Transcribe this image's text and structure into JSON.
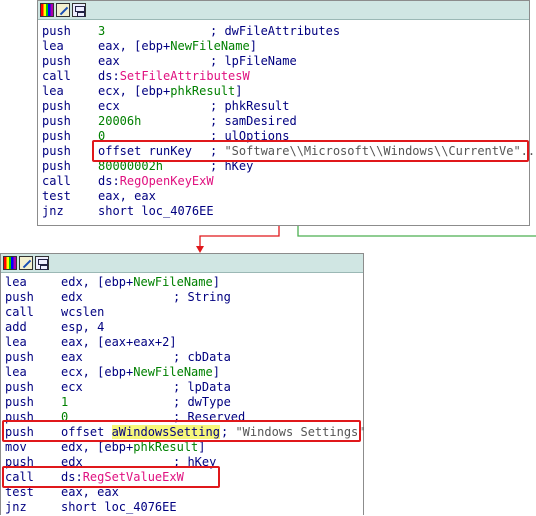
{
  "top_block": {
    "lines": [
      {
        "mn": "push",
        "op": [
          {
            "t": "3",
            "c": "num"
          }
        ],
        "cm": "; dwFileAttributes"
      },
      {
        "mn": "lea",
        "op": [
          {
            "t": "eax, [ebp+",
            "c": "op"
          },
          {
            "t": "NewFileName",
            "c": "sym"
          },
          {
            "t": "]",
            "c": "op"
          }
        ],
        "cm": ""
      },
      {
        "mn": "push",
        "op": [
          {
            "t": "eax",
            "c": "op"
          }
        ],
        "cm": "; lpFileName"
      },
      {
        "mn": "call",
        "op": [
          {
            "t": "ds:",
            "c": "op"
          },
          {
            "t": "SetFileAttributesW",
            "c": "imp"
          }
        ],
        "cm": ""
      },
      {
        "mn": "lea",
        "op": [
          {
            "t": "ecx, [ebp+",
            "c": "op"
          },
          {
            "t": "phkResult",
            "c": "sym"
          },
          {
            "t": "]",
            "c": "op"
          }
        ],
        "cm": ""
      },
      {
        "mn": "push",
        "op": [
          {
            "t": "ecx",
            "c": "op"
          }
        ],
        "cm": "; phkResult"
      },
      {
        "mn": "push",
        "op": [
          {
            "t": "20006h",
            "c": "num"
          }
        ],
        "cm": "; samDesired"
      },
      {
        "mn": "push",
        "op": [
          {
            "t": "0",
            "c": "num"
          }
        ],
        "cm": "; ulOptions"
      },
      {
        "mn": "push",
        "op": [
          {
            "t": "offset runKey",
            "c": "op"
          }
        ],
        "cm": "; ",
        "str": "\"Software\\\\Microsoft\\\\Windows\\\\CurrentVe\".."
      },
      {
        "mn": "push",
        "op": [
          {
            "t": "80000002h",
            "c": "num"
          }
        ],
        "cm": "; hKey"
      },
      {
        "mn": "call",
        "op": [
          {
            "t": "ds:",
            "c": "op"
          },
          {
            "t": "RegOpenKeyExW",
            "c": "imp"
          }
        ],
        "cm": ""
      },
      {
        "mn": "test",
        "op": [
          {
            "t": "eax, eax",
            "c": "op"
          }
        ],
        "cm": ""
      },
      {
        "mn": "jnz",
        "op": [
          {
            "t": "short loc_4076EE",
            "c": "op"
          }
        ],
        "cm": ""
      }
    ]
  },
  "bottom_block": {
    "lines": [
      {
        "mn": "lea",
        "op": [
          {
            "t": "edx, [ebp+",
            "c": "op"
          },
          {
            "t": "NewFileName",
            "c": "sym"
          },
          {
            "t": "]",
            "c": "op"
          }
        ],
        "cm": ""
      },
      {
        "mn": "push",
        "op": [
          {
            "t": "edx",
            "c": "op"
          }
        ],
        "cm": "; String"
      },
      {
        "mn": "call",
        "op": [
          {
            "t": "wcslen",
            "c": "op"
          }
        ],
        "cm": ""
      },
      {
        "mn": "add",
        "op": [
          {
            "t": "esp, 4",
            "c": "op"
          }
        ],
        "cm": ""
      },
      {
        "mn": "lea",
        "op": [
          {
            "t": "eax, [eax+eax+2]",
            "c": "op"
          }
        ],
        "cm": ""
      },
      {
        "mn": "push",
        "op": [
          {
            "t": "eax",
            "c": "op"
          }
        ],
        "cm": "; cbData"
      },
      {
        "mn": "lea",
        "op": [
          {
            "t": "ecx, [ebp+",
            "c": "op"
          },
          {
            "t": "NewFileName",
            "c": "sym"
          },
          {
            "t": "]",
            "c": "op"
          }
        ],
        "cm": ""
      },
      {
        "mn": "push",
        "op": [
          {
            "t": "ecx",
            "c": "op"
          }
        ],
        "cm": "; lpData"
      },
      {
        "mn": "push",
        "op": [
          {
            "t": "1",
            "c": "num"
          }
        ],
        "cm": "; dwType"
      },
      {
        "mn": "push",
        "op": [
          {
            "t": "0",
            "c": "num"
          }
        ],
        "cm": "; Reserved"
      },
      {
        "mn": "push",
        "op": [
          {
            "t": "offset ",
            "c": "op"
          },
          {
            "t": "aWindowsSetting",
            "c": "op",
            "hl": true
          }
        ],
        "cm": "; ",
        "str": "\"Windows Settings\""
      },
      {
        "mn": "mov",
        "op": [
          {
            "t": "edx, [ebp+",
            "c": "op"
          },
          {
            "t": "phkResult",
            "c": "sym"
          },
          {
            "t": "]",
            "c": "op"
          }
        ],
        "cm": ""
      },
      {
        "mn": "push",
        "op": [
          {
            "t": "edx",
            "c": "op"
          }
        ],
        "cm": "; hKey"
      },
      {
        "mn": "call",
        "op": [
          {
            "t": "ds:",
            "c": "op"
          },
          {
            "t": "RegSetValueExW",
            "c": "imp"
          }
        ],
        "cm": ""
      },
      {
        "mn": "test",
        "op": [
          {
            "t": "eax, eax",
            "c": "op"
          }
        ],
        "cm": ""
      },
      {
        "mn": "jnz",
        "op": [
          {
            "t": "short loc_4076EE",
            "c": "op"
          }
        ],
        "cm": ""
      }
    ]
  },
  "toolbar_icons": [
    "color-palette-icon",
    "edit-icon",
    "graph-icon"
  ],
  "colors": {
    "highlight_box": "#e0181b",
    "true_edge": "#4caf50",
    "false_edge": "#e0181b",
    "titlebar": "#d0e6e3"
  }
}
